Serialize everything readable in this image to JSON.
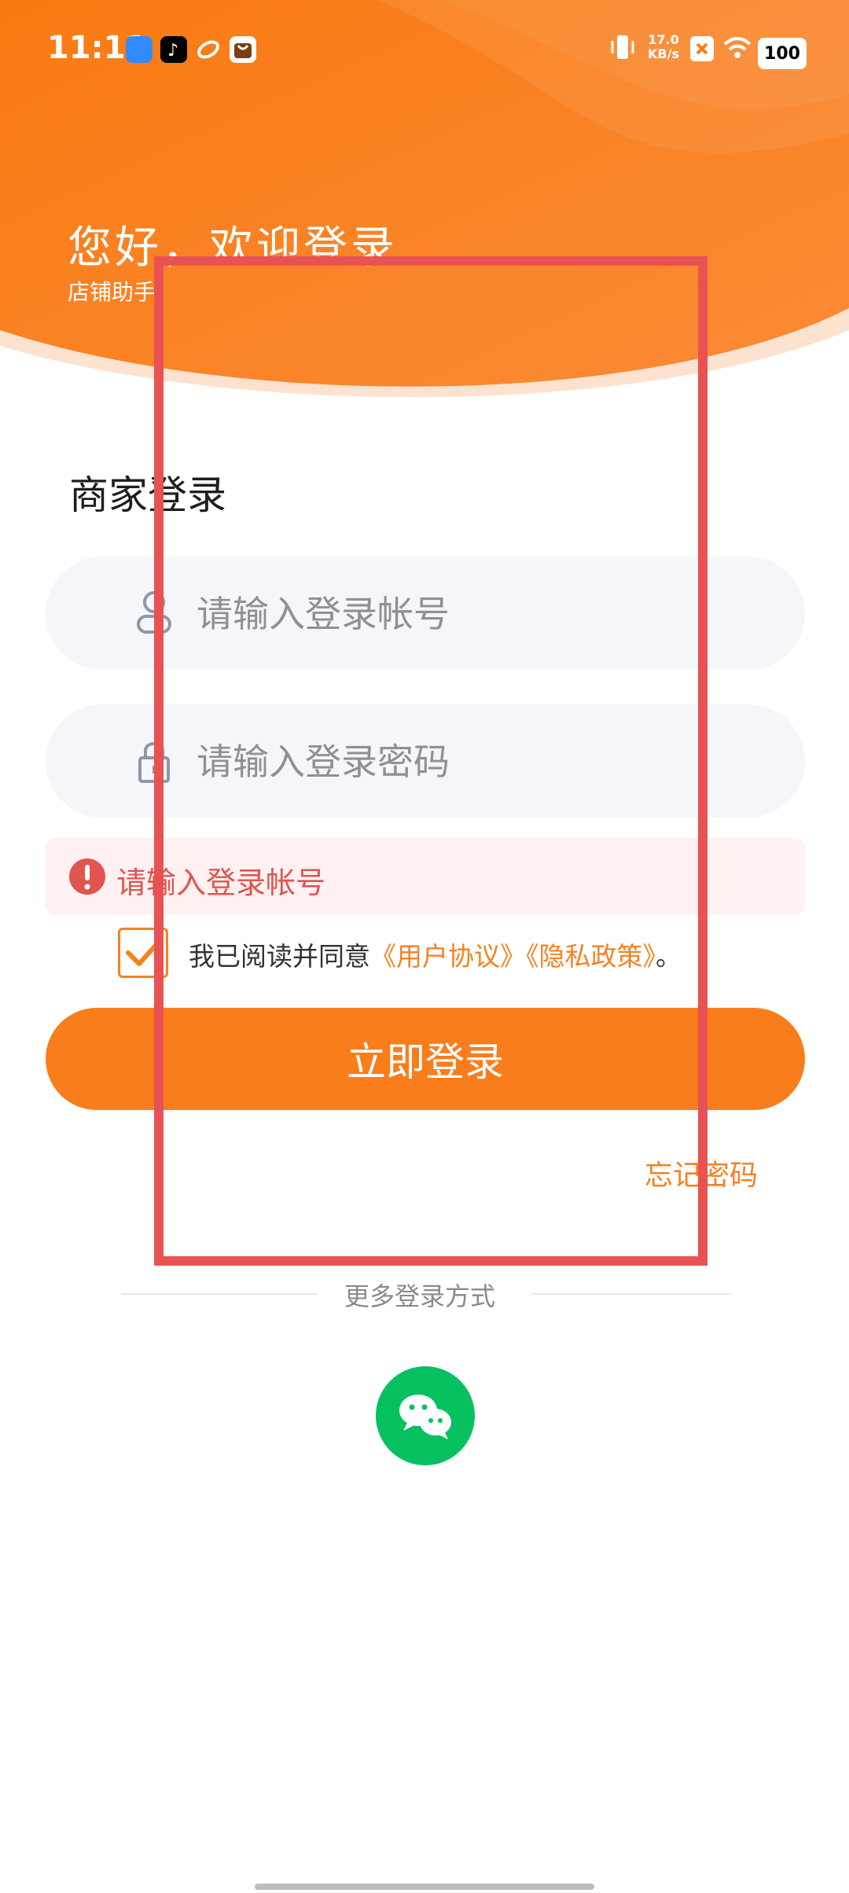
{
  "status_bar": {
    "time": "11:11",
    "net_speed_value": "17.0",
    "net_speed_unit": "KB/s",
    "battery": "100",
    "icons": [
      "app-icon",
      "tiktok-icon",
      "app-icon",
      "bag-icon",
      "vibrate-icon",
      "close-badge-icon",
      "wifi-icon",
      "battery-icon"
    ]
  },
  "header": {
    "welcome_title": "您好，欢迎登录",
    "subtitle": "店铺助手"
  },
  "login": {
    "section_title": "商家登录",
    "account_placeholder": "请输入登录帐号",
    "password_placeholder": "请输入登录密码",
    "error_message": "请输入登录帐号",
    "agree_prefix": "我已阅读并同意",
    "user_agreement": "《用户协议》",
    "privacy_policy": "《隐私政策》",
    "agree_suffix": "。",
    "login_button": "立即登录",
    "forgot_password": "忘记密码",
    "more_login": "更多登录方式"
  },
  "colors": {
    "accent": "#f97d1b",
    "error": "#e0554f",
    "wechat": "#07c160",
    "annotation": "#e95252"
  }
}
